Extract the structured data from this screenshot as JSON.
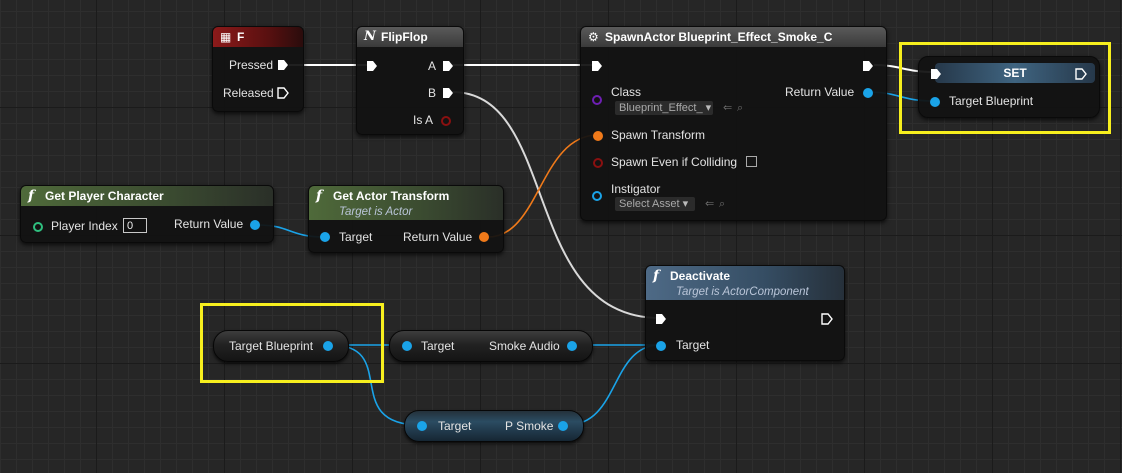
{
  "colors": {
    "exec": "#ffffff",
    "object": "#1aa3e8",
    "transform": "#f07a1a",
    "class": "#6e1fb3",
    "bool": "#8a1010",
    "int": "#2fbf7f",
    "highlight": "#f7ef1e"
  },
  "nodes": {
    "key_f": {
      "title": "F",
      "icon": "keyboard-icon",
      "pins": {
        "pressed": "Pressed",
        "released": "Released"
      }
    },
    "flipflop": {
      "title": "FlipFlop",
      "icon": "flipflop-icon",
      "pins": {
        "a": "A",
        "b": "B",
        "is_a": "Is A"
      }
    },
    "spawn": {
      "title": "SpawnActor Blueprint_Effect_Smoke_C",
      "icon": "spawn-icon",
      "pins": {
        "class": "Class",
        "class_value": "Blueprint_Effect_",
        "return_value": "Return Value",
        "spawn_transform": "Spawn Transform",
        "spawn_even": "Spawn Even if Colliding",
        "instigator": "Instigator",
        "instigator_value": "Select Asset"
      }
    },
    "set": {
      "title": "SET",
      "pins": {
        "target_blueprint": "Target Blueprint"
      }
    },
    "get_player": {
      "title": "Get Player Character",
      "icon": "function-icon",
      "pins": {
        "player_index": "Player Index",
        "player_index_value": "0",
        "return_value": "Return Value"
      }
    },
    "get_transform": {
      "title": "Get Actor Transform",
      "subtitle": "Target is Actor",
      "icon": "function-icon",
      "pins": {
        "target": "Target",
        "return_value": "Return Value"
      }
    },
    "deactivate": {
      "title": "Deactivate",
      "subtitle": "Target is ActorComponent",
      "icon": "function-icon",
      "pins": {
        "target": "Target"
      }
    },
    "target_blueprint": {
      "label": "Target Blueprint"
    },
    "smoke_audio": {
      "target": "Target",
      "label": "Smoke Audio"
    },
    "p_smoke": {
      "target": "Target",
      "label": "P Smoke"
    }
  }
}
